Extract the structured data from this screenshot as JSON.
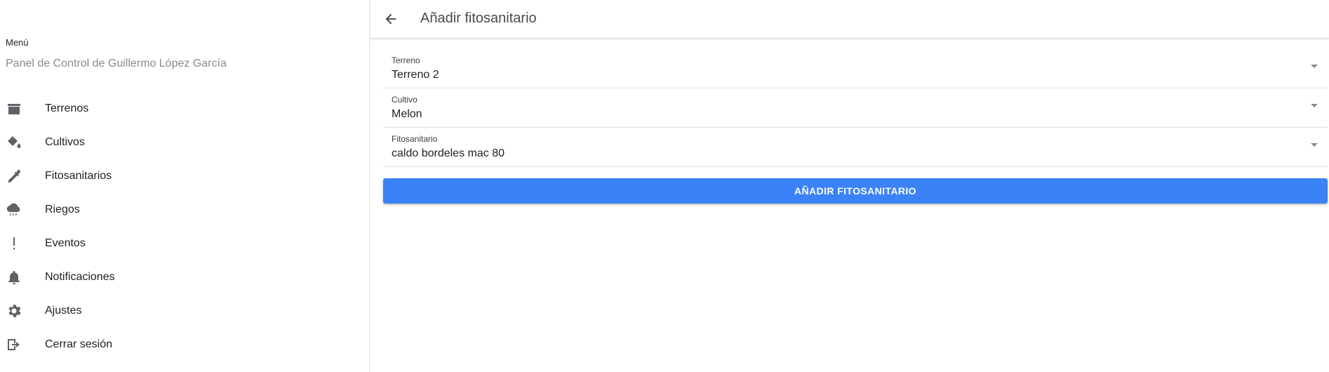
{
  "sidebar": {
    "menu_title": "Menú",
    "subtitle": "Panel de Control de Guillermo López García",
    "items": [
      {
        "label": "Terrenos",
        "icon": "archive-icon"
      },
      {
        "label": "Cultivos",
        "icon": "paint-bucket-icon"
      },
      {
        "label": "Fitosanitarios",
        "icon": "eyedropper-icon"
      },
      {
        "label": "Riegos",
        "icon": "rain-cloud-icon"
      },
      {
        "label": "Eventos",
        "icon": "exclamation-icon"
      },
      {
        "label": "Notificaciones",
        "icon": "bell-icon"
      },
      {
        "label": "Ajustes",
        "icon": "gear-icon"
      },
      {
        "label": "Cerrar sesión",
        "icon": "logout-icon"
      }
    ]
  },
  "header": {
    "title": "Añadir fitosanitario",
    "back_icon": "arrow-back-icon"
  },
  "form": {
    "terreno": {
      "label": "Terreno",
      "value": "Terreno 2"
    },
    "cultivo": {
      "label": "Cultivo",
      "value": "Melon"
    },
    "fitosanitario": {
      "label": "Fitosanitario",
      "value": "caldo bordeles mac 80"
    },
    "submit_label": "AÑADIR FITOSANITARIO"
  },
  "colors": {
    "accent": "#3b82f6",
    "icon": "#5f6368"
  }
}
